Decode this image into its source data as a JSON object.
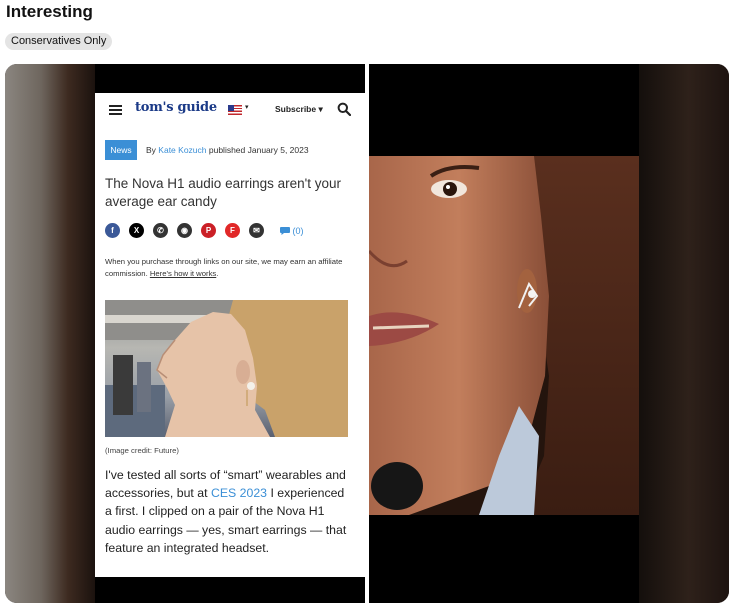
{
  "post": {
    "title": "Interesting",
    "community_badge": "Conservatives Only"
  },
  "article": {
    "site": {
      "logo": "tom's guide",
      "subscribe_label": "Subscribe ▾",
      "flag_caret": "▾"
    },
    "tag": "News",
    "byline": {
      "prefix": "By",
      "author": "Kate Kozuch",
      "published": "published January 5, 2023"
    },
    "headline": "The Nova H1 audio earrings aren't your average ear candy",
    "share_icons": [
      {
        "name": "facebook-icon",
        "glyph": "f",
        "color": "#3b5998"
      },
      {
        "name": "x-icon",
        "glyph": "X",
        "color": "#000000"
      },
      {
        "name": "whatsapp-icon",
        "glyph": "✆",
        "color": "#333333"
      },
      {
        "name": "reddit-icon",
        "glyph": "◉",
        "color": "#333333"
      },
      {
        "name": "pinterest-icon",
        "glyph": "P",
        "color": "#cb2027"
      },
      {
        "name": "flipboard-icon",
        "glyph": "F",
        "color": "#e12828"
      },
      {
        "name": "email-icon",
        "glyph": "✉",
        "color": "#333333"
      }
    ],
    "comment_count": "(0)",
    "affiliate": {
      "text": "When you purchase through links on our site, we may earn an affiliate commission.",
      "link": "Here's how it works"
    },
    "image_caption": "(Image credit: Future)",
    "body": {
      "before_link": "I've tested all sorts of “smart” wearables and accessories, but at",
      "link": "CES 2023",
      "after_link": "I experienced a first. I clipped on a pair of the Nova H1 audio earrings — yes, smart earrings — that feature an integrated headset."
    }
  },
  "colors": {
    "accent_blue": "#3b8fd6",
    "logo_navy": "#1b3a87",
    "badge_bg": "#e4e4e4"
  }
}
